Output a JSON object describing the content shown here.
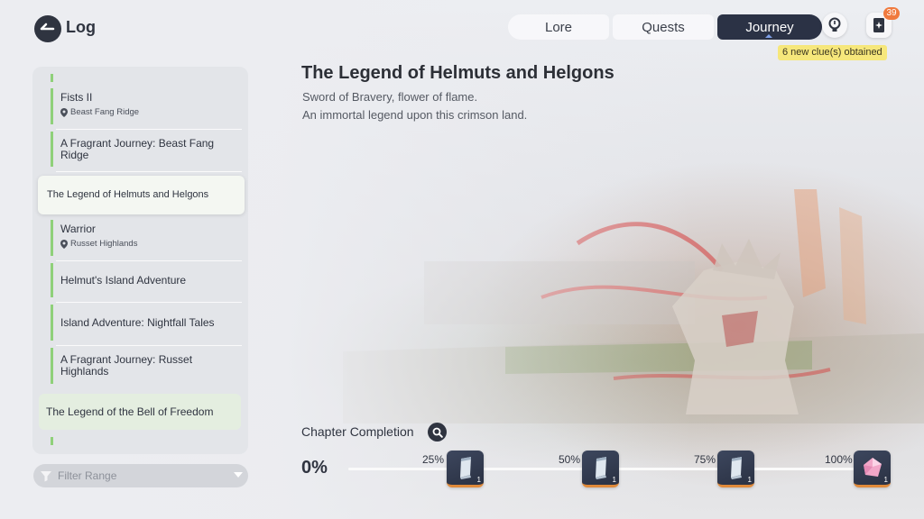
{
  "header": {
    "title": "Log",
    "tabs": [
      {
        "label": "Lore",
        "active": false
      },
      {
        "label": "Quests",
        "active": false
      },
      {
        "label": "Journey",
        "active": true
      }
    ],
    "clue_badge": "39",
    "clue_notice": "6 new clue(s) obtained"
  },
  "sidebar": {
    "items": [
      {
        "title": "Fists II",
        "location": "Beast Fang Ridge"
      },
      {
        "title": "A Fragrant Journey: Beast Fang Ridge"
      },
      {
        "title": "The Legend of Helmuts and Helgons",
        "selected": true
      },
      {
        "title": "Warrior",
        "location": "Russet Highlands"
      },
      {
        "title": "Helmut's Island Adventure"
      },
      {
        "title": "Island Adventure: Nightfall Tales"
      },
      {
        "title": "A Fragrant Journey: Russet Highlands"
      },
      {
        "title": "The Legend of the Bell of Freedom",
        "highlighted": true
      }
    ],
    "filter_placeholder": "Filter Range"
  },
  "main": {
    "title": "The Legend of Helmuts and Helgons",
    "lines": [
      "Sword of Bravery, flower of flame.",
      "An immortal legend upon this crimson land."
    ],
    "completion_label": "Chapter Completion",
    "completion_value": "0%",
    "milestones": [
      {
        "label": "25%",
        "reward": "scroll-icon",
        "qty": "1"
      },
      {
        "label": "50%",
        "reward": "scroll-icon",
        "qty": "1"
      },
      {
        "label": "75%",
        "reward": "scroll-icon",
        "qty": "1"
      },
      {
        "label": "100%",
        "reward": "crystal-icon",
        "qty": "1"
      }
    ]
  },
  "colors": {
    "accent_green": "#8fd07a",
    "active_tab": "#2b3245",
    "badge": "#f07a3e",
    "toast": "#f6e77b"
  }
}
